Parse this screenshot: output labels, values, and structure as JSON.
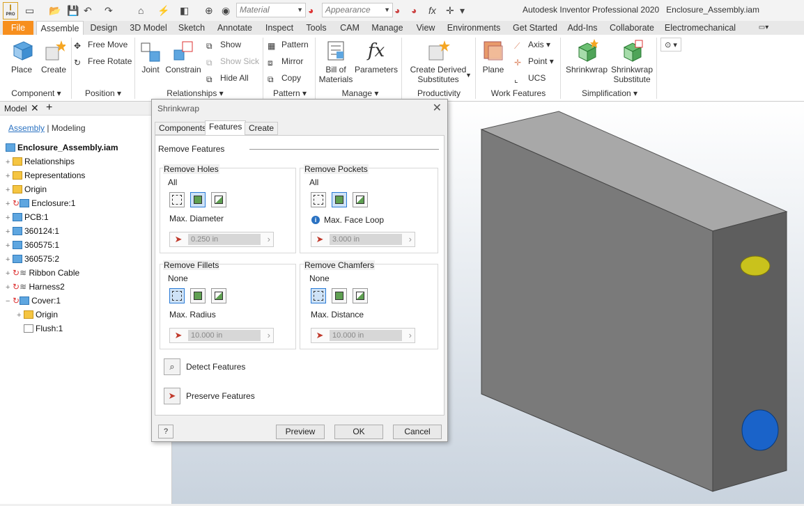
{
  "title": "Autodesk Inventor Professional 2020",
  "document": "Enclosure_Assembly.iam",
  "logo_text": "I",
  "logo_sub": "PRO",
  "qat": {
    "material_placeholder": "Material",
    "appearance_placeholder": "Appearance"
  },
  "tabs": [
    "File",
    "Assemble",
    "Design",
    "3D Model",
    "Sketch",
    "Annotate",
    "Inspect",
    "Tools",
    "CAM",
    "Manage",
    "View",
    "Environments",
    "Get Started",
    "Add-Ins",
    "Collaborate",
    "Electromechanical"
  ],
  "ribbon": {
    "component": {
      "label": "Component",
      "place": "Place",
      "create": "Create"
    },
    "position": {
      "label": "Position",
      "free_move": "Free Move",
      "free_rotate": "Free Rotate"
    },
    "relationships": {
      "label": "Relationships",
      "joint": "Joint",
      "constrain": "Constrain",
      "show": "Show",
      "show_sick": "Show Sick",
      "hide_all": "Hide All"
    },
    "pattern": {
      "label": "Pattern",
      "pattern": "Pattern",
      "mirror": "Mirror",
      "copy": "Copy"
    },
    "manage": {
      "label": "Manage",
      "bom_1": "Bill of",
      "bom_2": "Materials",
      "parameters": "Parameters"
    },
    "productivity": {
      "label": "Productivity",
      "cds_1": "Create Derived",
      "cds_2": "Substitutes"
    },
    "work_features": {
      "label": "Work Features",
      "plane": "Plane",
      "axis": "Axis",
      "point": "Point",
      "ucs": "UCS"
    },
    "simplification": {
      "label": "Simplification",
      "shrinkwrap": "Shrinkwrap",
      "shrinkwrap_sub_1": "Shrinkwrap",
      "shrinkwrap_sub_2": "Substitute"
    }
  },
  "browser": {
    "header": "Model",
    "tab_assembly": "Assembly",
    "tab_modeling": "Modeling",
    "root": "Enclosure_Assembly.iam",
    "items": [
      "Relationships",
      "Representations",
      "Origin",
      "Enclosure:1",
      "PCB:1",
      "360124:1",
      "360575:1",
      "360575:2",
      "Ribbon Cable",
      "Harness2",
      "Cover:1",
      "Origin",
      "Flush:1"
    ]
  },
  "dialog": {
    "title": "Shrinkwrap",
    "tabs": [
      "Components",
      "Features",
      "Create"
    ],
    "section": "Remove Features",
    "holes": {
      "label": "Remove Holes",
      "mode": "All",
      "param": "Max. Diameter",
      "value": "0.250 in"
    },
    "pockets": {
      "label": "Remove Pockets",
      "mode": "All",
      "param": "Max. Face Loop",
      "value": "3.000 in"
    },
    "fillets": {
      "label": "Remove Fillets",
      "mode": "None",
      "param": "Max. Radius",
      "value": "10.000 in"
    },
    "chamfers": {
      "label": "Remove Chamfers",
      "mode": "None",
      "param": "Max. Distance",
      "value": "10.000 in"
    },
    "detect": "Detect Features",
    "preserve": "Preserve Features",
    "buttons": {
      "preview": "Preview",
      "ok": "OK",
      "cancel": "Cancel"
    }
  }
}
